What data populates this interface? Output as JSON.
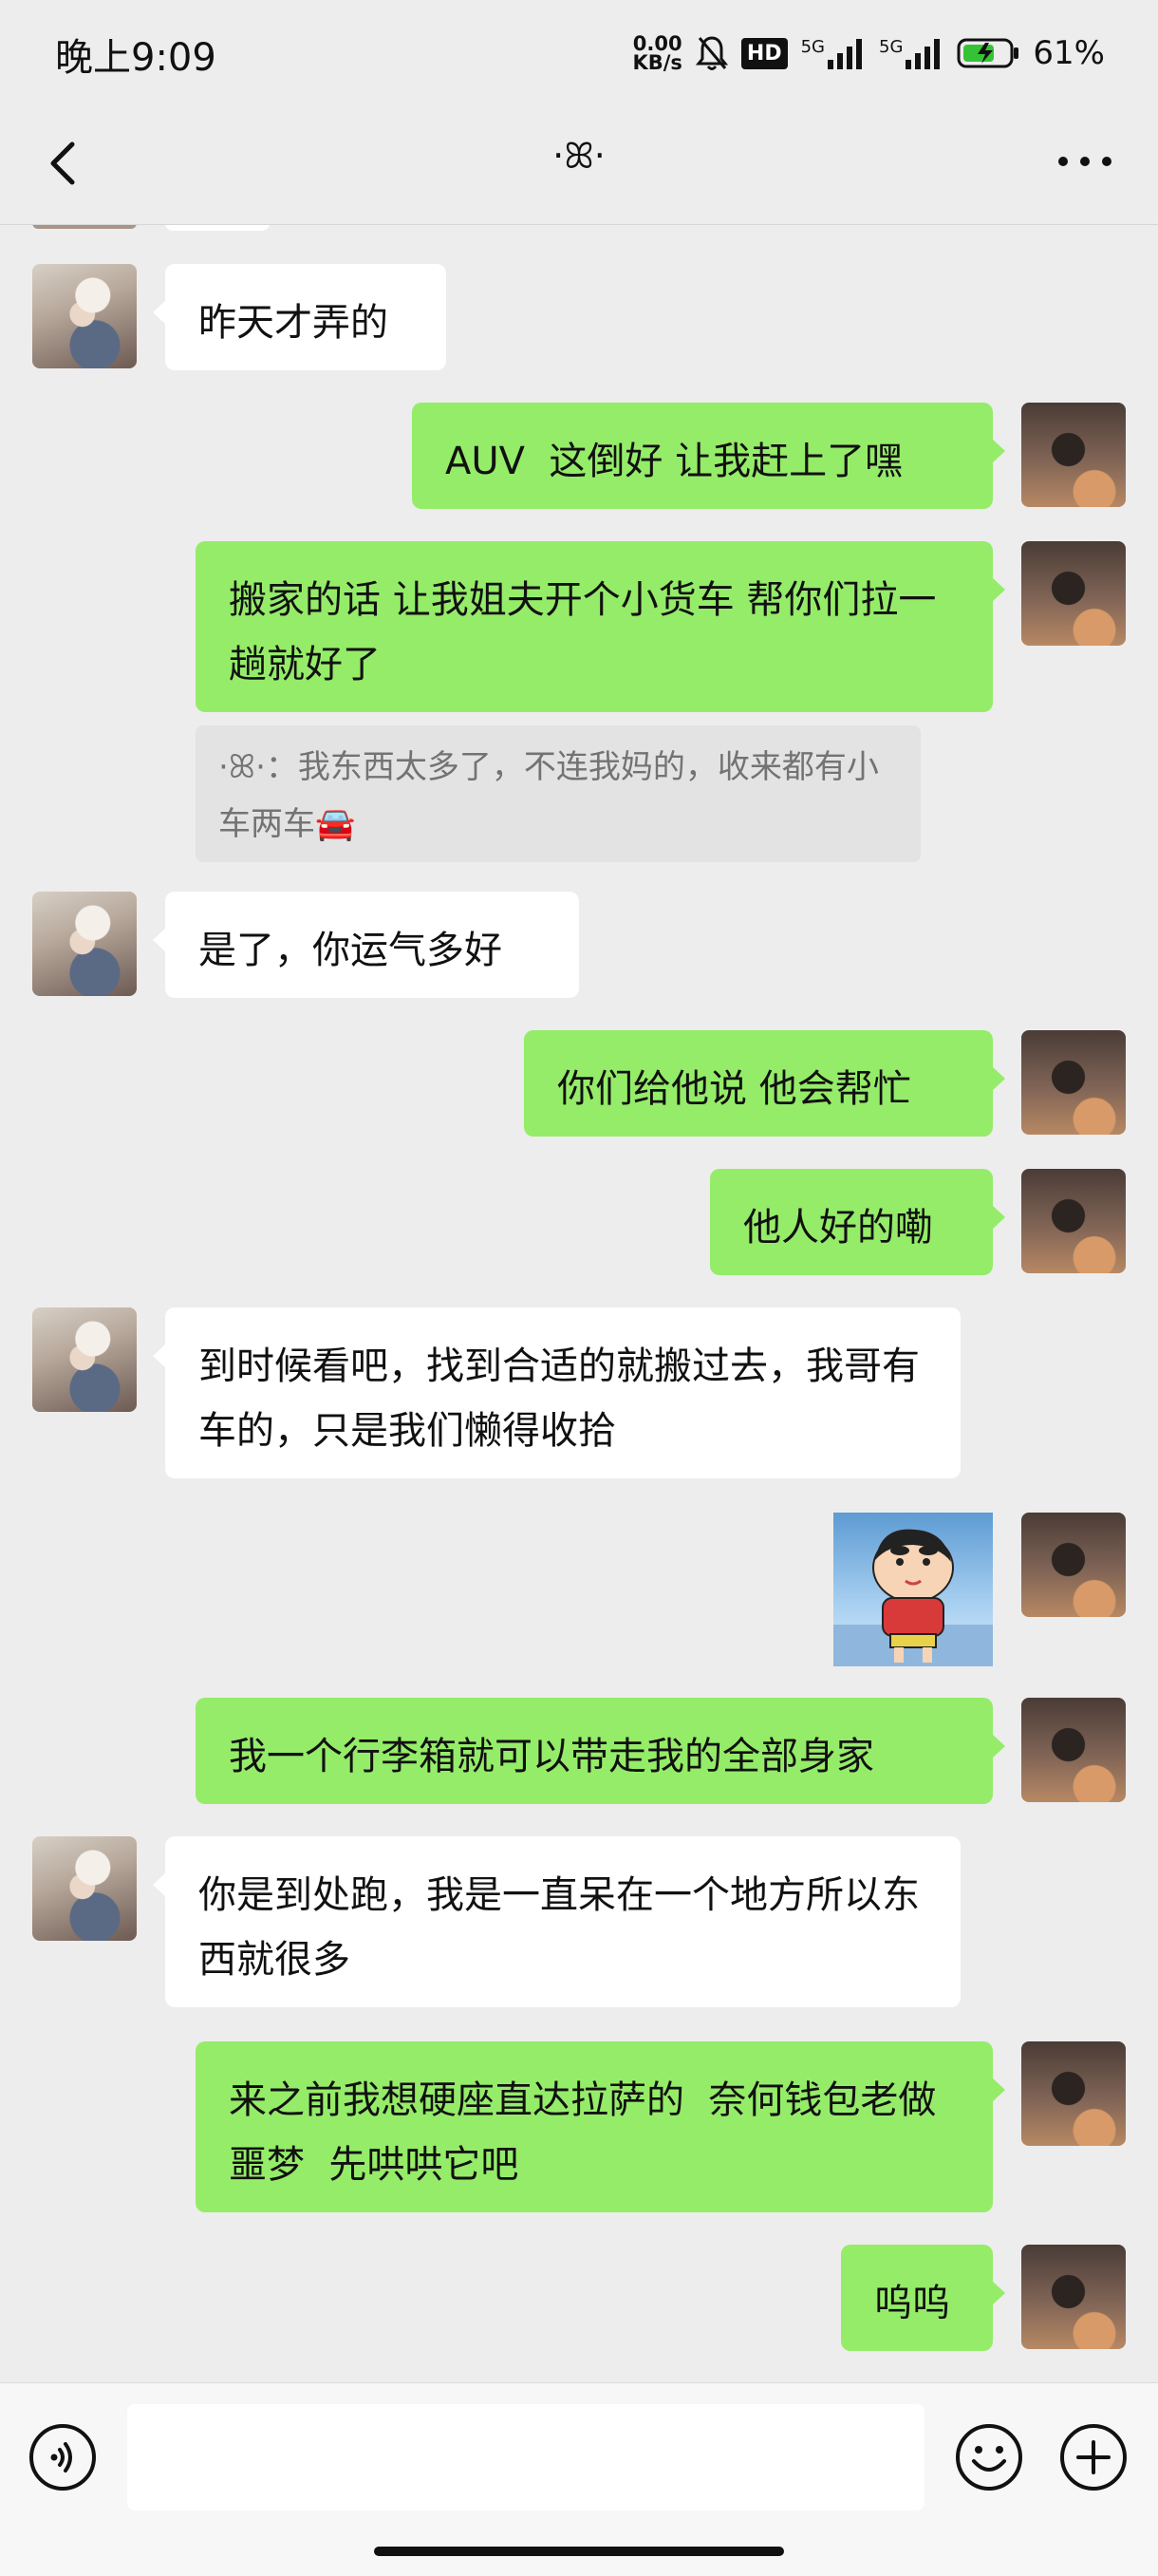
{
  "status_bar": {
    "time": "晚上9:09",
    "net_speed_value": "0.00",
    "net_speed_unit": "KB/s",
    "hd_label": "HD",
    "signal_1_label": "5G",
    "signal_2_label": "5G",
    "battery_percent": "61%"
  },
  "nav": {
    "title": "·ꕤ·"
  },
  "messages": [
    {
      "side": "other",
      "text": "昨天才弄的"
    },
    {
      "side": "me",
      "text": "AUV  这倒好 让我赶上了嘿"
    },
    {
      "side": "me",
      "text": "搬家的话 让我姐夫开个小货车 帮你们拉一趟就好了"
    },
    {
      "side": "quote",
      "text": "·ꕤ·：我东西太多了，不连我妈的，收来都有小车两车🚘"
    },
    {
      "side": "other",
      "text": "是了，你运气多好"
    },
    {
      "side": "me",
      "text": "你们给他说 他会帮忙"
    },
    {
      "side": "me",
      "text": "他人好的嘞"
    },
    {
      "side": "other",
      "text": "到时候看吧，找到合适的就搬过去，我哥有车的，只是我们懒得收拾"
    },
    {
      "side": "me",
      "type": "sticker",
      "text": ""
    },
    {
      "side": "me",
      "text": "我一个行李箱就可以带走我的全部身家"
    },
    {
      "side": "other",
      "text": "你是到处跑，我是一直呆在一个地方所以东西就很多"
    },
    {
      "side": "me",
      "text": "来之前我想硬座直达拉萨的  奈何钱包老做噩梦  先哄哄它吧"
    },
    {
      "side": "me",
      "text": "呜呜"
    }
  ],
  "input": {
    "placeholder": "",
    "value": ""
  },
  "icons": {
    "back": "chevron-left-icon",
    "more": "more-dots-icon",
    "voice": "voice-icon",
    "emoji": "emoji-icon",
    "plus": "plus-icon"
  },
  "colors": {
    "my_bubble": "#95ec69",
    "other_bubble": "#ffffff",
    "background": "#ededed"
  }
}
